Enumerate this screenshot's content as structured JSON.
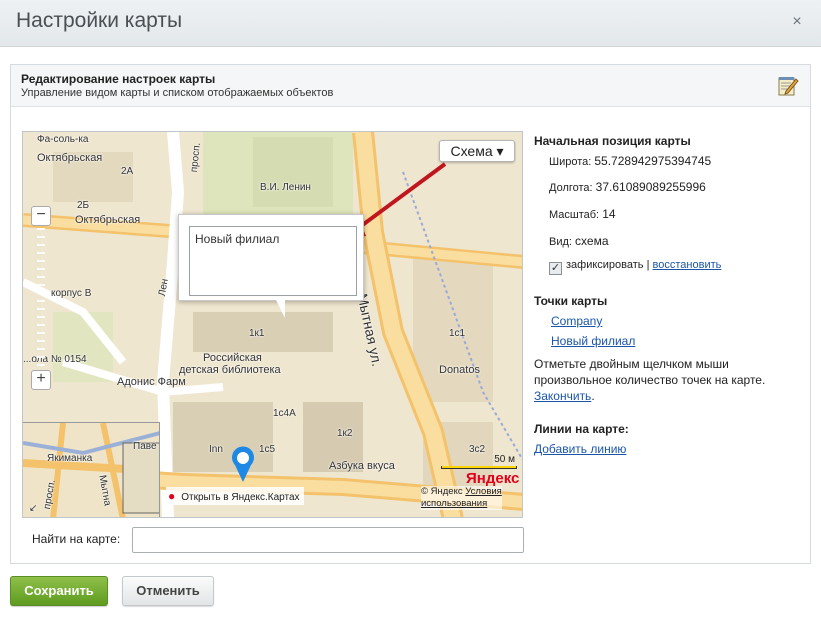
{
  "dialog": {
    "title": "Настройки карты",
    "close_glyph": "×"
  },
  "panel": {
    "title": "Редактирование настроек карты",
    "subtitle": "Управление видом карты и списком отображаемых объектов",
    "edit_icon": "edit-notepad-icon"
  },
  "map": {
    "type_button": "Схема ▾",
    "balloon_text": "Новый филиал",
    "open_link": "Открыть в Яндекс.Картах",
    "scale_label": "50 м",
    "logo_text": "Яндекс",
    "copyright_prefix": "© Яндекс",
    "terms_link_1": "Условия",
    "terms_link_2": "использования",
    "labels": {
      "fasolka": "Фа-соль-ка",
      "oktyabrskaya_1": "Октябрьская",
      "oktyabrskaya_2": "Октябрьская",
      "b2a": "2А",
      "b2b": "2Б",
      "prosp": "просп.",
      "lenin": "В.И. Ленин",
      "korpus_v": "корпус В",
      "lenin_road": "Лен",
      "school": "...ола № 0154",
      "adonis": "Адонис Фарм",
      "library_1": "Российская",
      "library_2": "детская библиотека",
      "b1k1": "1к1",
      "b1c1": "1с1",
      "donatos": "Donatos",
      "mytnaya": "Мытная ул.",
      "b1c4a": "1с4А",
      "b1k2": "1к2",
      "b1c5": "1с5",
      "inn": "Inn",
      "azbuka": "Азбука вкуса",
      "b3c2": "3с2",
      "mini_yakimanka": "Якиманка",
      "mini_pave": "Паве",
      "mini_mytna": "Мытна",
      "mini_prosp": "просп."
    }
  },
  "search": {
    "label": "Найти на карте:",
    "value": ""
  },
  "settings": {
    "position_header": "Начальная позиция карты",
    "lat_label": "Широта:",
    "lat_value": "55.728942975394745",
    "lon_label": "Долгота:",
    "lon_value": "37.61089089255996",
    "scale_label": "Масштаб:",
    "scale_value": "14",
    "view_label": "Вид:",
    "view_value": "схема",
    "fix_checked": true,
    "fix_label": "зафиксировать",
    "separator": "|",
    "restore_link": "восстановить",
    "points_header": "Точки карты",
    "points": [
      "Company",
      "Новый филиал"
    ],
    "points_hint": "Отметьте двойным щелчком мыши произвольное количество точек на карте.",
    "finish_link": "Закончить",
    "lines_header": "Линии на карте:",
    "add_line_link": "Добавить линию"
  },
  "buttons": {
    "save": "Сохранить",
    "cancel": "Отменить"
  },
  "colors": {
    "save_button": "#6aa62a",
    "link": "#1a55a8",
    "arrow": "#c0161d",
    "road": "#f3c26b"
  }
}
